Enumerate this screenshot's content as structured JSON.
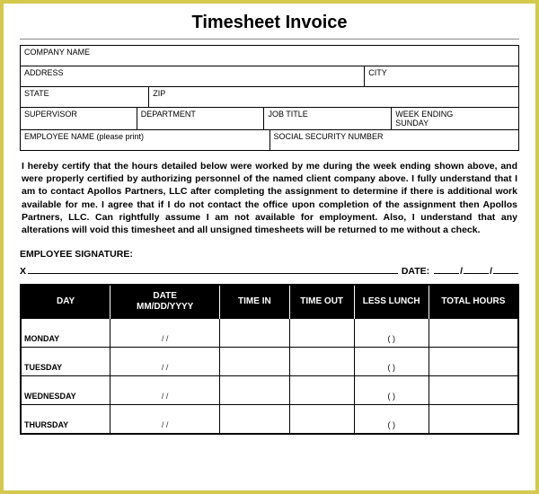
{
  "title": "Timesheet  Invoice",
  "info": {
    "company": "COMPANY NAME",
    "address": "ADDRESS",
    "city": "CITY",
    "state": "STATE",
    "zip": "ZIP",
    "supervisor": "SUPERVISOR",
    "department": "DEPARTMENT",
    "jobtitle": "JOB TITLE",
    "weekending": "WEEK ENDING",
    "sunday": "SUNDAY",
    "employee": "EMPLOYEE NAME (please print)",
    "ssn": "SOCIAL SECURITY NUMBER"
  },
  "certification": "I hereby certify that the hours detailed below were worked by me during the week ending shown above, and were properly certified by authorizing personnel of the named client company above.  I fully understand that I am to contact Apollos Partners, LLC after completing the assignment to determine if there is additional work available for me.  I agree that if I do not contact the office upon completion of the assignment then Apollos Partners, LLC. Can rightfully assume I am not available for employment.   Also, I understand that any alterations will void this timesheet and all unsigned timesheets will be returned to me without a check.",
  "signature": {
    "label": "EMPLOYEE SIGNATURE:",
    "x": "X",
    "date_label": "DATE:",
    "slash": "/"
  },
  "table": {
    "headers": {
      "day": "DAY",
      "date": "DATE",
      "date2": "MM/DD/YYYY",
      "timein": "TIME IN",
      "timeout": "TIME OUT",
      "lunch": "LESS LUNCH",
      "total": "TOTAL HOURS"
    },
    "date_placeholder": "/         /",
    "lunch_placeholder": "(       )",
    "rows": [
      {
        "day": "MONDAY"
      },
      {
        "day": "TUESDAY"
      },
      {
        "day": "WEDNESDAY"
      },
      {
        "day": "THURSDAY"
      }
    ]
  }
}
